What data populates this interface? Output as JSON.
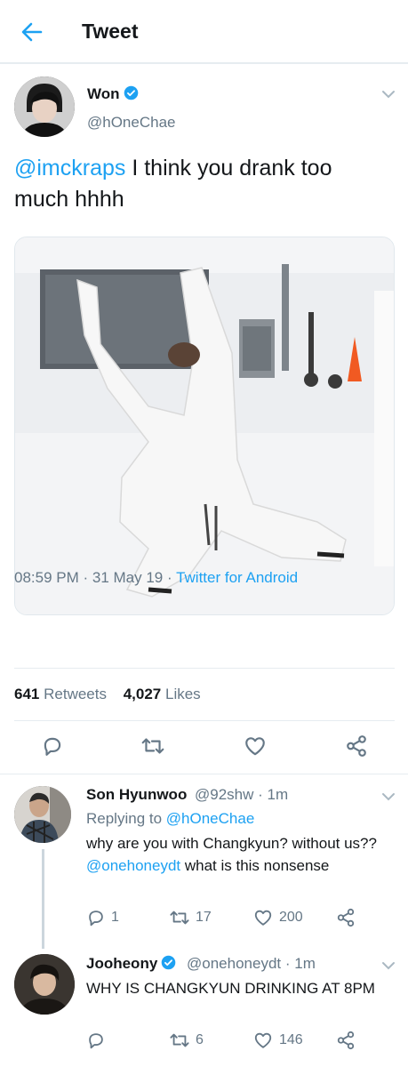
{
  "header": {
    "title": "Tweet",
    "back_icon": "arrow-left-icon"
  },
  "tweet": {
    "name": "Won",
    "handle": "@hOneChae",
    "verified": true,
    "mention": "@imckraps",
    "text": " I think you drank too much  hhhh",
    "time": "08:59 PM",
    "date": "31 May 19",
    "source": "Twitter for Android",
    "retweets_count": "641",
    "retweets_label": "Retweets",
    "likes_count": "4,027",
    "likes_label": "Likes"
  },
  "replies": [
    {
      "name": "Son Hyunwoo",
      "handle": "@92shw",
      "time": "1m",
      "replying_label": "Replying to",
      "replying_to": "@hOneChae",
      "text_before": "why are you with Changkyun? without us?? ",
      "mention": "@onehoneydt",
      "text_after": " what is this nonsense",
      "replies_count": "1",
      "retweets_count": "17",
      "likes_count": "200"
    },
    {
      "name": "Jooheony",
      "handle": "@onehoneydt",
      "time": "1m",
      "verified": true,
      "text": "WHY IS CHANGKYUN DRINKING AT 8PM",
      "retweets_count": "6",
      "likes_count": "146"
    }
  ],
  "colors": {
    "accent": "#1da1f2",
    "secondary_text": "#657786",
    "primary_text": "#14171a",
    "divider": "#e6ecf0"
  }
}
